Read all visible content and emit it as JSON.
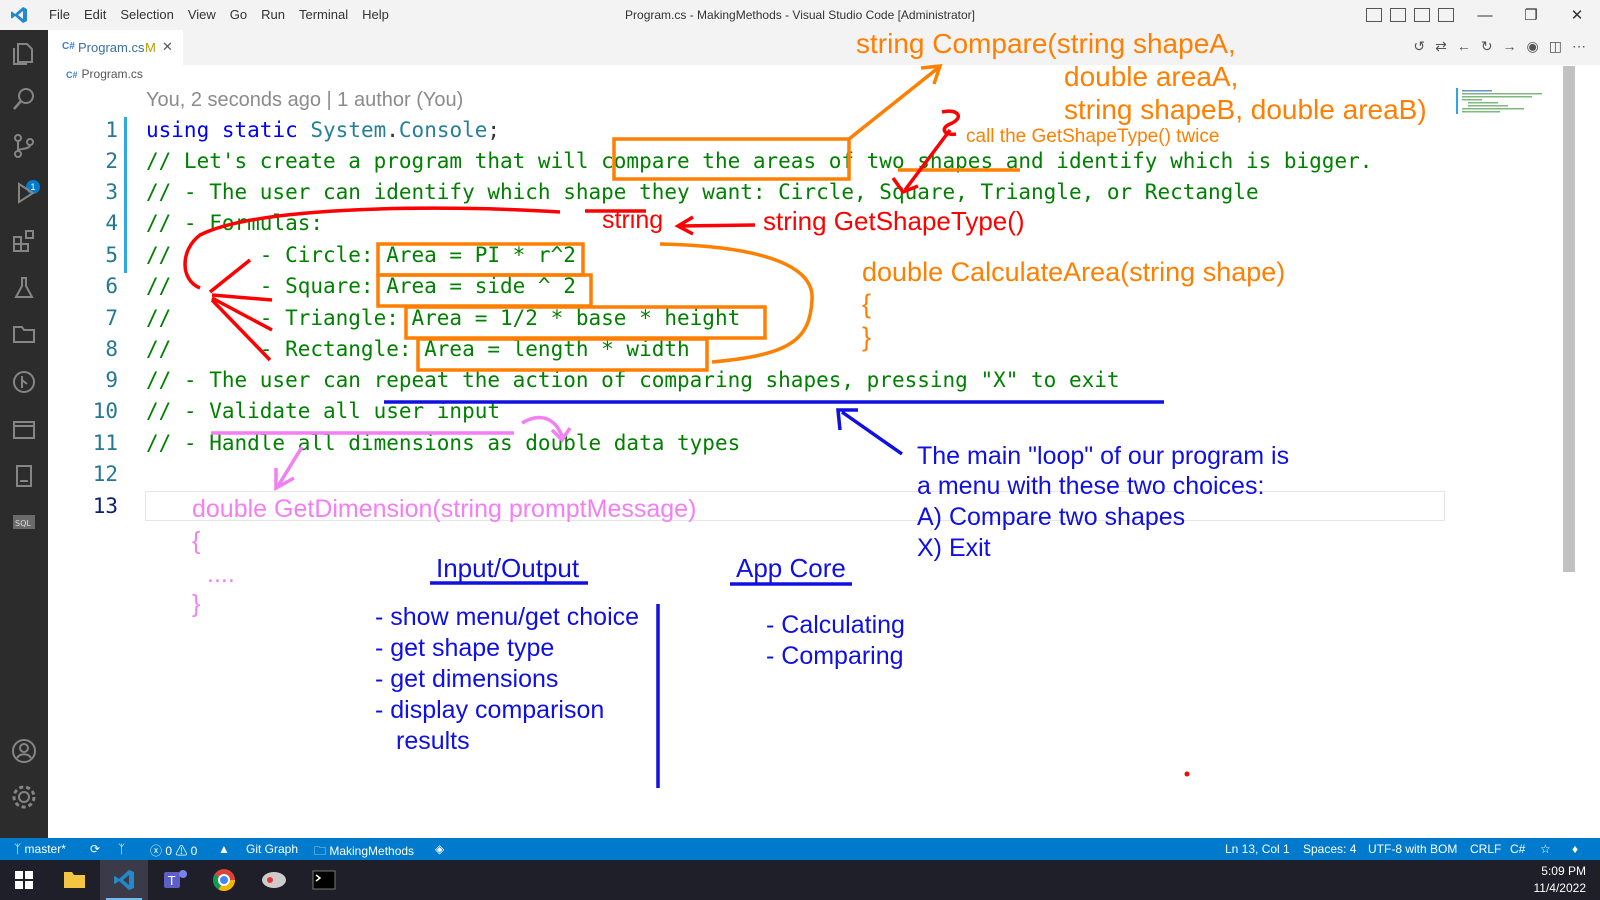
{
  "titlebar": {
    "menu": [
      "File",
      "Edit",
      "Selection",
      "View",
      "Go",
      "Run",
      "Terminal",
      "Help"
    ],
    "window_title": "Program.cs - MakingMethods - Visual Studio Code [Administrator]"
  },
  "tab": {
    "filename": "Program.cs",
    "modified_marker": "M",
    "icon_text": "C#"
  },
  "breadcrumb": {
    "file": "Program.cs"
  },
  "blame": "You, 2 seconds ago | 1 author (You)",
  "code": {
    "line_numbers": [
      "1",
      "2",
      "3",
      "4",
      "5",
      "6",
      "7",
      "8",
      "9",
      "10",
      "11",
      "12",
      "13"
    ],
    "l1": {
      "kw1": "using",
      "kw2": "static",
      "ty1": "System",
      "dot": ".",
      "ty2": "Console",
      "semi": ";"
    },
    "l2": "// Let's create a program that will compare the areas of two shapes and identify which is bigger.",
    "l3": "// - The user can identify which shape they want: Circle, Square, Triangle, or Rectangle",
    "l4": "// - Formulas:",
    "l5": "//       - Circle: Area = PI * r^2",
    "l6": "//       - Square: Area = side ^ 2",
    "l7": "//       - Triangle: Area = 1/2 * base * height",
    "l8": "//       - Rectangle: Area = length * width",
    "l9": "// - The user can repeat the action of comparing shapes, pressing \"X\" to exit",
    "l10": "// - Validate all user input",
    "l11": "// - Handle all dimensions as double data types"
  },
  "annotations": {
    "compare_sig_1": "string Compare(string shapeA,",
    "compare_sig_2": "double areaA,",
    "compare_sig_3": "string shapeB, double areaB)",
    "call_twice": "call the GetShapeType() twice",
    "string_word": "string",
    "get_shape_type": "string GetShapeType()",
    "calc_area_sig": "double CalculateArea(string shape)",
    "brace_open": "{",
    "brace_close": "}",
    "loop_1": "The main \"loop\" of our program is",
    "loop_2": "a menu with these two choices:",
    "loop_3": "A) Compare two shapes",
    "loop_4": "X) Exit",
    "get_dim_sig": "double GetDimension(string promptMessage)",
    "pink_open": "{",
    "pink_dots": "....",
    "pink_close": "}",
    "io_heading": "Input/Output",
    "io_items": [
      "- show menu/get choice",
      "- get shape type",
      "- get dimensions",
      "- display comparison",
      "results"
    ],
    "core_heading": "App Core",
    "core_items": [
      "- Calculating",
      "- Comparing"
    ],
    "colors": {
      "orange": "#ff7f00",
      "red": "#ff0000",
      "blue": "#1010e0",
      "pink": "#f47ef4"
    }
  },
  "statusbar": {
    "branch": "master*",
    "problems": "ⓧ 0 ⚠ 0",
    "git_graph": "Git Graph",
    "folder": "MakingMethods",
    "position": "Ln 13, Col 1",
    "spaces": "Spaces: 4",
    "encoding": "UTF-8 with BOM",
    "eol": "CRLF",
    "language": "C#"
  },
  "taskbar": {
    "time": "5:09 PM",
    "date": "11/4/2022"
  }
}
